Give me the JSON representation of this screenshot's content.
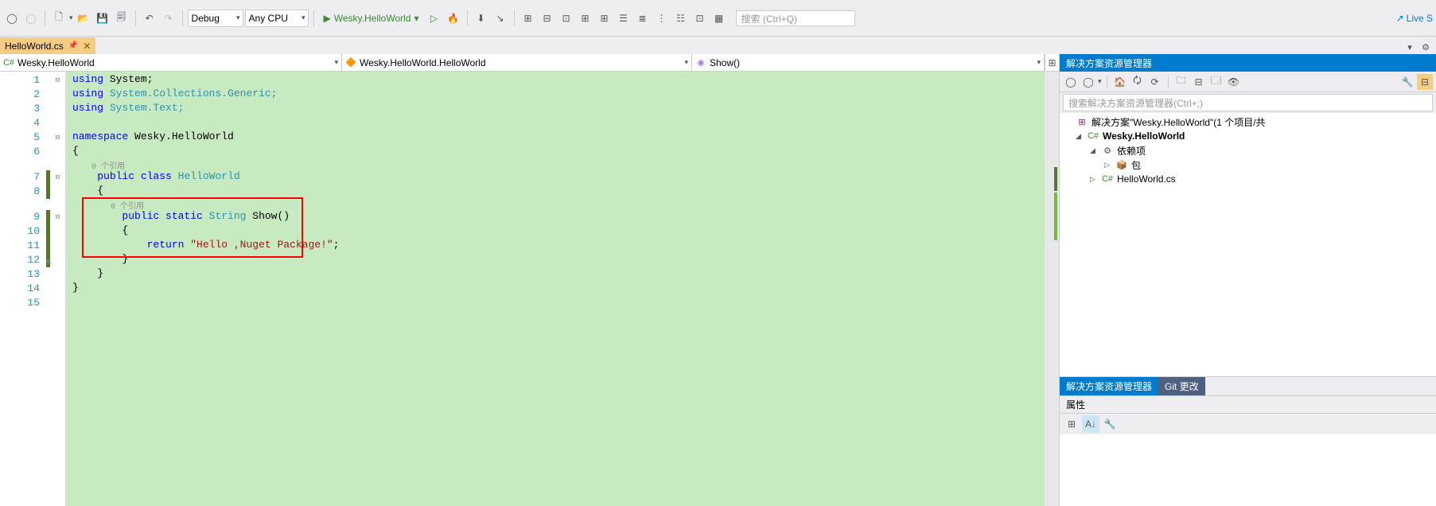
{
  "toolbar": {
    "config": "Debug",
    "platform": "Any CPU",
    "start_target": "Wesky.HelloWorld",
    "search_placeholder": "搜索 (Ctrl+Q)",
    "live_share": "Live S"
  },
  "tab": {
    "filename": "HelloWorld.cs"
  },
  "nav": {
    "project": "Wesky.HelloWorld",
    "class": "Wesky.HelloWorld.HelloWorld",
    "member": "Show()"
  },
  "code": {
    "lines": [
      "1",
      "2",
      "3",
      "4",
      "5",
      "6",
      "7",
      "8",
      "9",
      "10",
      "11",
      "12",
      "13",
      "14",
      "15"
    ],
    "l1_using": "using",
    "l1_sys": " System;",
    "l2_using": "using",
    "l2_ns": " System.Collections.Generic;",
    "l3_using": "using",
    "l3_ns": " System.Text;",
    "l5_ns_kw": "namespace",
    "l5_ns": " Wesky.HelloWorld",
    "l6": "{",
    "codelens1": "0 个引用",
    "l7_pub": "public",
    "l7_cls": " class ",
    "l7_name": "HelloWorld",
    "l8": "{",
    "codelens2": "0 个引用",
    "l9_pub": "public",
    "l9_stat": " static ",
    "l9_type": "String",
    "l9_name": " Show()",
    "l10": "{",
    "l11_ret": "return",
    "l11_str": " \"Hello ,Nuget Package!\"",
    "l11_end": ";",
    "l12": "}",
    "l13": "}",
    "l14": "}"
  },
  "solution_explorer": {
    "title": "解决方案资源管理器",
    "search_placeholder": "搜索解决方案资源管理器(Ctrl+;)",
    "solution": "解决方案\"Wesky.HelloWorld\"(1 个项目/共",
    "project": "Wesky.HelloWorld",
    "dependencies": "依赖项",
    "packages": "包",
    "file": "HelloWorld.cs"
  },
  "bottom_tabs": {
    "sln": "解决方案资源管理器",
    "git": "Git 更改"
  },
  "properties": {
    "title": "属性"
  }
}
